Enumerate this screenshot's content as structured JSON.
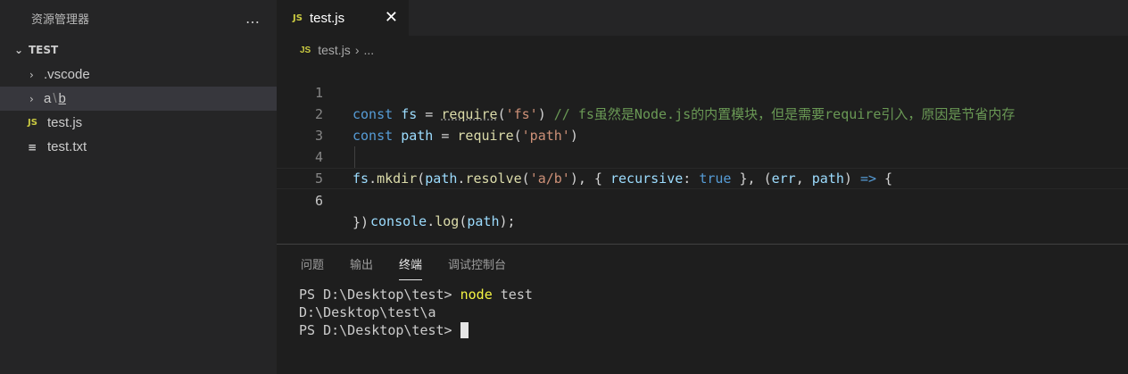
{
  "explorer": {
    "title": "资源管理器",
    "more_icon": "…",
    "section": "TEST",
    "items": [
      {
        "type": "folder",
        "label": ".vscode"
      },
      {
        "type": "folder",
        "label_a": "a",
        "label_sep": "\\",
        "label_b": "b"
      },
      {
        "type": "file",
        "badge": "JS",
        "label": "test.js"
      },
      {
        "type": "file",
        "badge": "≡",
        "label": "test.txt"
      }
    ]
  },
  "tab": {
    "badge": "JS",
    "label": "test.js",
    "close": "✕"
  },
  "breadcrumb": {
    "badge": "JS",
    "file": "test.js",
    "sep": "›",
    "rest": "..."
  },
  "editor": {
    "line_numbers": [
      "1",
      "2",
      "3",
      "4",
      "5",
      "6"
    ],
    "line1": {
      "kw": "const",
      "var": "fs",
      "eq": " = ",
      "fn": "require",
      "open": "(",
      "str": "'fs'",
      "close": ")",
      "comment": "// fs虽然是Node.js的内置模块，但是需要require引入，原因是节省内存"
    },
    "line2": {
      "kw": "const",
      "var": "path",
      "eq": " = ",
      "fn": "require",
      "open": "(",
      "str": "'path'",
      "close": ")"
    },
    "line4": {
      "obj": "fs",
      "dot": ".",
      "fn": "mkdir",
      "open": "(",
      "obj2": "path",
      "dot2": ".",
      "fn2": "resolve",
      "open2": "(",
      "str": "'a/b'",
      "close2": "), { ",
      "key": "recursive",
      "colon": ": ",
      "val": "true",
      "after": " }, (",
      "p1": "err",
      "comma": ", ",
      "p2": "path",
      "arrow_pre": ") ",
      "arrow": "=>",
      "brace": " {"
    },
    "line5": {
      "obj": "console",
      "dot": ".",
      "fn": "log",
      "open": "(",
      "arg": "path",
      "close": ");"
    },
    "line6": {
      "text": "})"
    }
  },
  "panel": {
    "tabs": [
      "问题",
      "输出",
      "终端",
      "调试控制台"
    ],
    "active_tab": "终端"
  },
  "terminal": {
    "line1_prompt": "PS D:\\Desktop\\test> ",
    "line1_cmd": "node",
    "line1_arg": " test",
    "line2": "D:\\Desktop\\test\\a",
    "line3_prompt": "PS D:\\Desktop\\test> "
  }
}
